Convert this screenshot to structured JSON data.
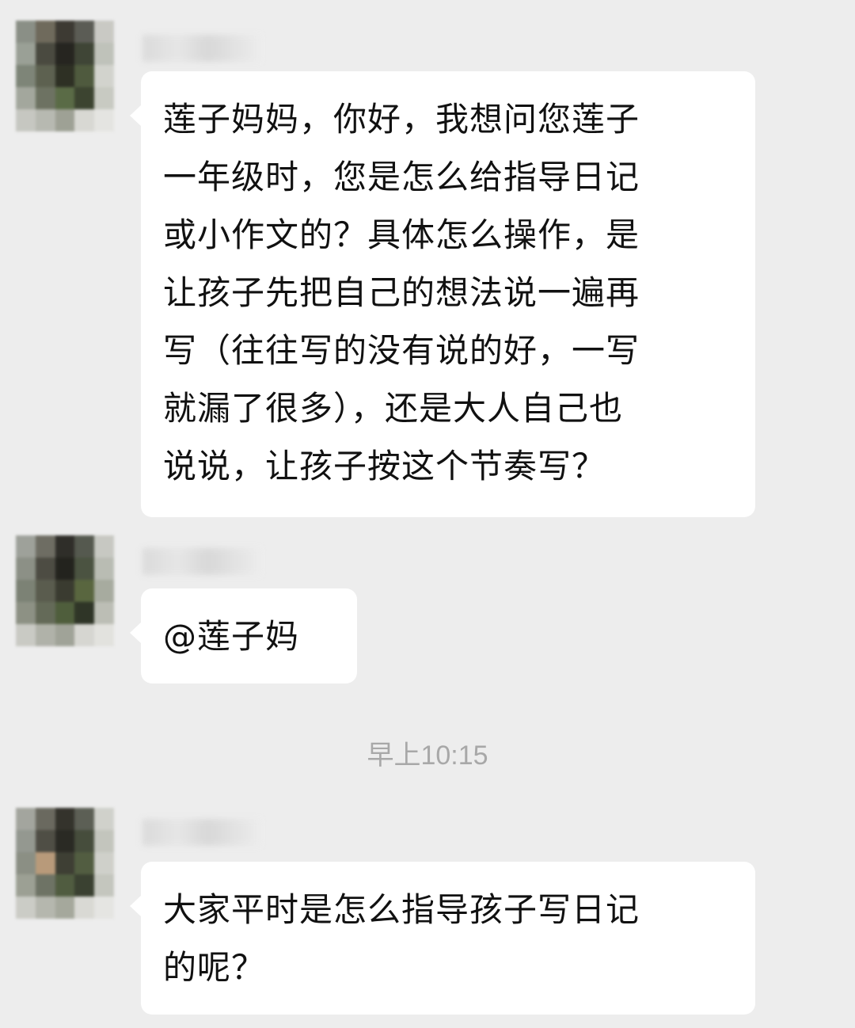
{
  "messages": [
    {
      "sender_name": "",
      "avatar_colors": [
        "#8a8f86",
        "#6f6a5c",
        "#3d3a33",
        "#5b5c55",
        "#c9c9c4",
        "#9aa096",
        "#4a4a40",
        "#262520",
        "#3f4536",
        "#bfc2ba",
        "#7e8578",
        "#5d6150",
        "#2e3024",
        "#4f5a3e",
        "#d2d3cd",
        "#a3a79d",
        "#6d7262",
        "#5a6b46",
        "#3c4430",
        "#c8cac2",
        "#c6c7c1",
        "#b7b9b1",
        "#9ea195",
        "#d8d8d3",
        "#e4e4e1"
      ],
      "lines": [
        "莲子妈妈，你好，我想问您莲子",
        "一年级时，您是怎么给指导日记",
        "或小作文的？具体怎么操作，是",
        "让孩子先把自己的想法说一遍再",
        "写（往往写的没有说的好，一写",
        "就漏了很多），还是大人自己也",
        "说说，让孩子按这个节奏写？"
      ]
    },
    {
      "sender_name": "",
      "avatar_colors": [
        "#9ea19a",
        "#6e6d63",
        "#2f2e29",
        "#55594f",
        "#c7c8c2",
        "#8c9086",
        "#4d4c43",
        "#23231e",
        "#4b5341",
        "#b9bcb3",
        "#7c8275",
        "#5a5c4e",
        "#3a3b30",
        "#59663f",
        "#a7ab9f",
        "#8d9184",
        "#646a58",
        "#4f5e3c",
        "#2f3527",
        "#bcbeb5",
        "#c9cac4",
        "#b0b2a9",
        "#a0a398",
        "#d6d6d1",
        "#e2e2de"
      ],
      "lines": [
        "@莲子妈"
      ]
    },
    {
      "sender_name": "",
      "avatar_colors": [
        "#a3a59e",
        "#6a695f",
        "#34332c",
        "#5c5f55",
        "#d0d1cb",
        "#949890",
        "#4f4e45",
        "#2a2a24",
        "#464d3c",
        "#c3c5bd",
        "#8b8f84",
        "#b89a7a",
        "#3e3f34",
        "#525d41",
        "#cfd0ca",
        "#9ca094",
        "#6e7365",
        "#505c40",
        "#3a4131",
        "#c4c6be",
        "#cbccc6",
        "#b5b7ae",
        "#a5a89c",
        "#d9d9d4",
        "#e5e5e2"
      ],
      "lines": [
        "大家平时是怎么指导孩子写日记",
        "的呢？"
      ]
    }
  ],
  "timestamp": "早上10:15",
  "colors": {
    "background": "#ededed",
    "bubble": "#ffffff",
    "text": "#111111",
    "timestamp": "#a8a8a8"
  }
}
